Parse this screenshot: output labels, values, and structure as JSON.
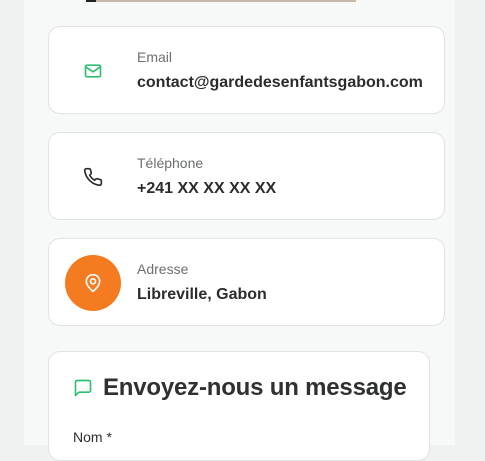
{
  "contact": {
    "email": {
      "label": "Email",
      "value": "contact@gardedesenfantsgabon.com",
      "icon": "mail-icon"
    },
    "phone": {
      "label": "Téléphone",
      "value": "+241 XX XX XX XX",
      "icon": "phone-icon"
    },
    "address": {
      "label": "Adresse",
      "value": "Libreville, Gabon",
      "icon": "map-pin-icon"
    }
  },
  "form": {
    "title": "Envoyez-nous un message",
    "title_icon": "message-square-icon",
    "name_label": "Nom *"
  },
  "colors": {
    "accent_green": "#2fbf71",
    "accent_orange": "#f47b20"
  }
}
